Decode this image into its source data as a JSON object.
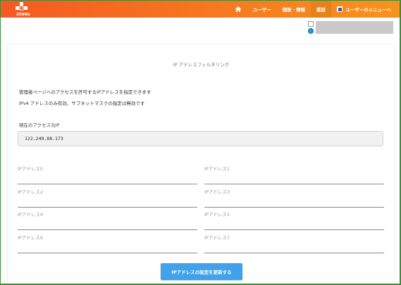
{
  "brand": {
    "name": "ZENNU",
    "color": "#f45a22"
  },
  "nav": {
    "home_icon": "home-icon",
    "items": [
      {
        "label": "ユーザー"
      },
      {
        "label": "施設・情報"
      },
      {
        "label": "認証",
        "active": true
      },
      {
        "label": "ユーザーのメニューへ",
        "icon": "menu-icon"
      }
    ]
  },
  "page": {
    "title": "IP アドレスフィルタリング",
    "description_1": "管理者ページへのアクセスを許可するIPアドレスを指定できます",
    "description_2": "IPv4 アドレスのみ有効、サブネットマスクの指定は無効です",
    "current_ip_label": "現在のアクセス元IP",
    "current_ip_value": "122.249.88.173"
  },
  "ip_fields": [
    {
      "label": "IPアドレス0",
      "value": ""
    },
    {
      "label": "IPアドレス1",
      "value": ""
    },
    {
      "label": "IPアドレス2",
      "value": ""
    },
    {
      "label": "IPアドレス3",
      "value": ""
    },
    {
      "label": "IPアドレス4",
      "value": ""
    },
    {
      "label": "IPアドレス5",
      "value": ""
    },
    {
      "label": "IPアドレス6",
      "value": ""
    },
    {
      "label": "IPアドレス7",
      "value": ""
    }
  ],
  "submit_label": "IPアドレスの設定を更新する",
  "colors": {
    "accent": "#3fa2ea",
    "header_start": "#f45a22",
    "header_end": "#f7931e"
  }
}
